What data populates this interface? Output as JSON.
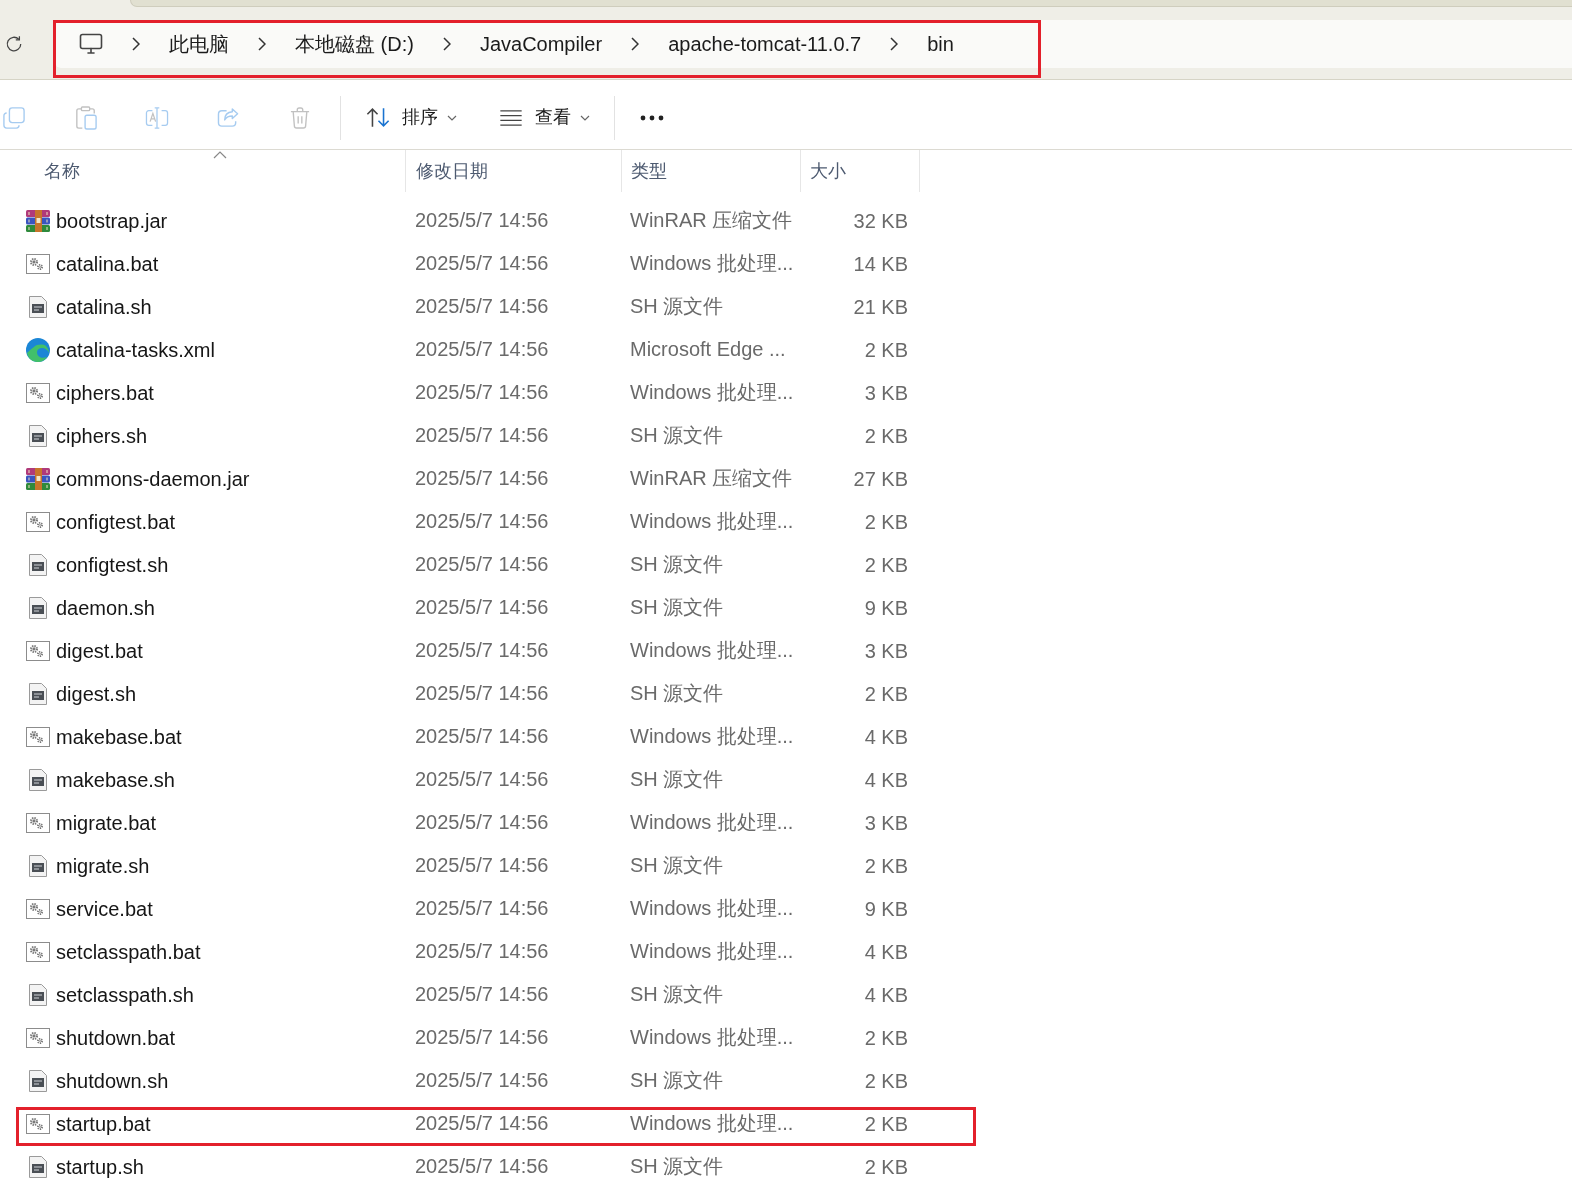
{
  "address_bar": {
    "highlighted": true,
    "breadcrumbs": [
      "此电脑",
      "本地磁盘 (D:)",
      "JavaCompiler",
      "apache-tomcat-11.0.7",
      "bin"
    ]
  },
  "toolbar": {
    "actions": [
      {
        "kind": "copy",
        "disabled": true
      },
      {
        "kind": "paste",
        "disabled": true
      },
      {
        "kind": "rename",
        "disabled": true
      },
      {
        "kind": "share",
        "disabled": true
      },
      {
        "kind": "delete",
        "disabled": true
      }
    ],
    "menus": [
      {
        "kind": "sort",
        "label": "排序"
      },
      {
        "kind": "view",
        "label": "查看"
      }
    ]
  },
  "columns": [
    {
      "label": "名称",
      "sorted": true
    },
    {
      "label": "修改日期",
      "sorted": false
    },
    {
      "label": "类型",
      "sorted": false
    },
    {
      "label": "大小",
      "sorted": false
    }
  ],
  "rows": [
    {
      "kind": "archive",
      "name": "bootstrap.jar",
      "modified": "2025/5/7 14:56",
      "type": "WinRAR 压缩文件",
      "size": "32 KB",
      "highlighted": false
    },
    {
      "kind": "batch",
      "name": "catalina.bat",
      "modified": "2025/5/7 14:56",
      "type": "Windows 批处理...",
      "size": "14 KB",
      "highlighted": false
    },
    {
      "kind": "script",
      "name": "catalina.sh",
      "modified": "2025/5/7 14:56",
      "type": "SH 源文件",
      "size": "21 KB",
      "highlighted": false
    },
    {
      "kind": "web",
      "name": "catalina-tasks.xml",
      "modified": "2025/5/7 14:56",
      "type": "Microsoft Edge ...",
      "size": "2 KB",
      "highlighted": false
    },
    {
      "kind": "batch",
      "name": "ciphers.bat",
      "modified": "2025/5/7 14:56",
      "type": "Windows 批处理...",
      "size": "3 KB",
      "highlighted": false
    },
    {
      "kind": "script",
      "name": "ciphers.sh",
      "modified": "2025/5/7 14:56",
      "type": "SH 源文件",
      "size": "2 KB",
      "highlighted": false
    },
    {
      "kind": "archive",
      "name": "commons-daemon.jar",
      "modified": "2025/5/7 14:56",
      "type": "WinRAR 压缩文件",
      "size": "27 KB",
      "highlighted": false
    },
    {
      "kind": "batch",
      "name": "configtest.bat",
      "modified": "2025/5/7 14:56",
      "type": "Windows 批处理...",
      "size": "2 KB",
      "highlighted": false
    },
    {
      "kind": "script",
      "name": "configtest.sh",
      "modified": "2025/5/7 14:56",
      "type": "SH 源文件",
      "size": "2 KB",
      "highlighted": false
    },
    {
      "kind": "script",
      "name": "daemon.sh",
      "modified": "2025/5/7 14:56",
      "type": "SH 源文件",
      "size": "9 KB",
      "highlighted": false
    },
    {
      "kind": "batch",
      "name": "digest.bat",
      "modified": "2025/5/7 14:56",
      "type": "Windows 批处理...",
      "size": "3 KB",
      "highlighted": false
    },
    {
      "kind": "script",
      "name": "digest.sh",
      "modified": "2025/5/7 14:56",
      "type": "SH 源文件",
      "size": "2 KB",
      "highlighted": false
    },
    {
      "kind": "batch",
      "name": "makebase.bat",
      "modified": "2025/5/7 14:56",
      "type": "Windows 批处理...",
      "size": "4 KB",
      "highlighted": false
    },
    {
      "kind": "script",
      "name": "makebase.sh",
      "modified": "2025/5/7 14:56",
      "type": "SH 源文件",
      "size": "4 KB",
      "highlighted": false
    },
    {
      "kind": "batch",
      "name": "migrate.bat",
      "modified": "2025/5/7 14:56",
      "type": "Windows 批处理...",
      "size": "3 KB",
      "highlighted": false
    },
    {
      "kind": "script",
      "name": "migrate.sh",
      "modified": "2025/5/7 14:56",
      "type": "SH 源文件",
      "size": "2 KB",
      "highlighted": false
    },
    {
      "kind": "batch",
      "name": "service.bat",
      "modified": "2025/5/7 14:56",
      "type": "Windows 批处理...",
      "size": "9 KB",
      "highlighted": false
    },
    {
      "kind": "batch",
      "name": "setclasspath.bat",
      "modified": "2025/5/7 14:56",
      "type": "Windows 批处理...",
      "size": "4 KB",
      "highlighted": false
    },
    {
      "kind": "script",
      "name": "setclasspath.sh",
      "modified": "2025/5/7 14:56",
      "type": "SH 源文件",
      "size": "4 KB",
      "highlighted": false
    },
    {
      "kind": "batch",
      "name": "shutdown.bat",
      "modified": "2025/5/7 14:56",
      "type": "Windows 批处理...",
      "size": "2 KB",
      "highlighted": false
    },
    {
      "kind": "script",
      "name": "shutdown.sh",
      "modified": "2025/5/7 14:56",
      "type": "SH 源文件",
      "size": "2 KB",
      "highlighted": false
    },
    {
      "kind": "batch",
      "name": "startup.bat",
      "modified": "2025/5/7 14:56",
      "type": "Windows 批处理...",
      "size": "2 KB",
      "highlighted": true
    },
    {
      "kind": "script",
      "name": "startup.sh",
      "modified": "2025/5/7 14:56",
      "type": "SH 源文件",
      "size": "2 KB",
      "highlighted": false
    }
  ]
}
